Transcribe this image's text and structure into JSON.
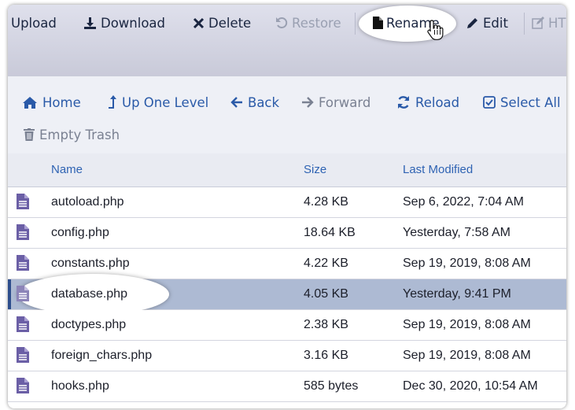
{
  "toolbar": {
    "upload": "Upload",
    "download": "Download",
    "delete": "Delete",
    "restore": "Restore",
    "rename": "Rename",
    "edit": "Edit",
    "html_editor": "HT"
  },
  "navbar": {
    "home": "Home",
    "up_one_level": "Up One Level",
    "back": "Back",
    "forward": "Forward",
    "reload": "Reload",
    "select_all": "Select All",
    "empty_trash": "Empty Trash"
  },
  "table": {
    "headers": {
      "name": "Name",
      "size": "Size",
      "last_modified": "Last Modified"
    },
    "rows": [
      {
        "name": "autoload.php",
        "size": "4.28 KB",
        "modified": "Sep 6, 2022, 7:04 AM"
      },
      {
        "name": "config.php",
        "size": "18.64 KB",
        "modified": "Yesterday, 7:58 AM"
      },
      {
        "name": "constants.php",
        "size": "4.22 KB",
        "modified": "Sep 19, 2019, 8:08 AM"
      },
      {
        "name": "database.php",
        "size": "4.05 KB",
        "modified": "Yesterday, 9:41 PM"
      },
      {
        "name": "doctypes.php",
        "size": "2.38 KB",
        "modified": "Sep 19, 2019, 8:08 AM"
      },
      {
        "name": "foreign_chars.php",
        "size": "3.16 KB",
        "modified": "Sep 19, 2019, 8:08 AM"
      },
      {
        "name": "hooks.php",
        "size": "585 bytes",
        "modified": "Dec 30, 2020, 10:54 AM"
      }
    ]
  },
  "colors": {
    "file_icon": "#6b5fa6",
    "link_blue": "#2a5aa8",
    "selected_row": "#adbad3"
  },
  "icons": {
    "download": "download-icon",
    "delete": "x-icon",
    "restore": "undo-icon",
    "rename": "file-icon",
    "edit": "pencil-icon",
    "html_editor": "pencil-square-icon",
    "home": "home-icon",
    "up": "level-up-icon",
    "back": "arrow-left-icon",
    "forward": "arrow-right-icon",
    "reload": "refresh-icon",
    "select_all": "check-square-icon",
    "trash": "trash-icon",
    "file": "php-file-icon"
  }
}
